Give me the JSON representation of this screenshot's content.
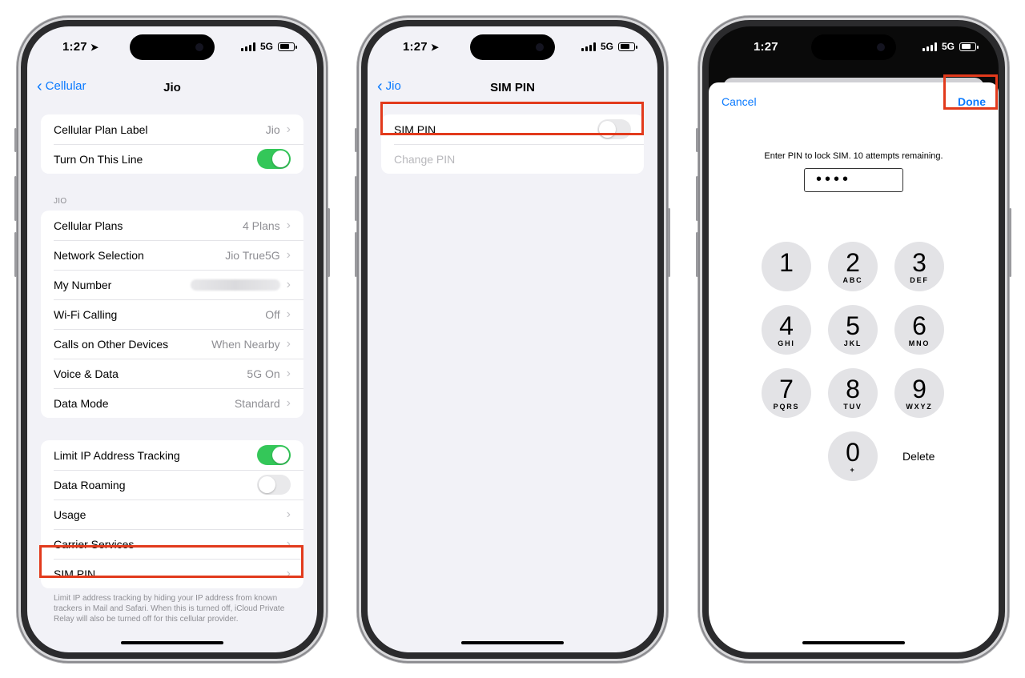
{
  "status": {
    "time": "1:27",
    "network": "5G"
  },
  "phone1": {
    "back_label": "Cellular",
    "title": "Jio",
    "group1": [
      {
        "label": "Cellular Plan Label",
        "value": "Jio"
      },
      {
        "label": "Turn On This Line",
        "toggle": "on"
      }
    ],
    "section_header": "JIO",
    "group2": [
      {
        "label": "Cellular Plans",
        "value": "4 Plans"
      },
      {
        "label": "Network Selection",
        "value": "Jio True5G"
      },
      {
        "label": "My Number",
        "value": ""
      },
      {
        "label": "Wi-Fi Calling",
        "value": "Off"
      },
      {
        "label": "Calls on Other Devices",
        "value": "When Nearby"
      },
      {
        "label": "Voice & Data",
        "value": "5G On"
      },
      {
        "label": "Data Mode",
        "value": "Standard"
      }
    ],
    "group3": [
      {
        "label": "Limit IP Address Tracking",
        "toggle": "on"
      },
      {
        "label": "Data Roaming",
        "toggle": "off"
      },
      {
        "label": "Usage"
      },
      {
        "label": "Carrier Services"
      },
      {
        "label": "SIM PIN"
      }
    ],
    "footer": "Limit IP address tracking by hiding your IP address from known trackers in Mail and Safari. When this is turned off, iCloud Private Relay will also be turned off for this cellular provider."
  },
  "phone2": {
    "back_label": "Jio",
    "title": "SIM PIN",
    "rows": [
      {
        "label": "SIM PIN",
        "toggle": "off"
      },
      {
        "label": "Change PIN"
      }
    ]
  },
  "phone3": {
    "cancel_label": "Cancel",
    "done_label": "Done",
    "prompt": "Enter PIN to lock SIM. 10 attempts remaining.",
    "pin_masked": "••••",
    "keys": [
      {
        "digit": "1",
        "letters": ""
      },
      {
        "digit": "2",
        "letters": "ABC"
      },
      {
        "digit": "3",
        "letters": "DEF"
      },
      {
        "digit": "4",
        "letters": "GHI"
      },
      {
        "digit": "5",
        "letters": "JKL"
      },
      {
        "digit": "6",
        "letters": "MNO"
      },
      {
        "digit": "7",
        "letters": "PQRS"
      },
      {
        "digit": "8",
        "letters": "TUV"
      },
      {
        "digit": "9",
        "letters": "WXYZ"
      },
      {
        "digit": "0",
        "letters": "+"
      }
    ],
    "delete_label": "Delete"
  },
  "colors": {
    "accent": "#0a7aff",
    "toggle_on": "#34c759",
    "highlight": "#e23a1c"
  }
}
